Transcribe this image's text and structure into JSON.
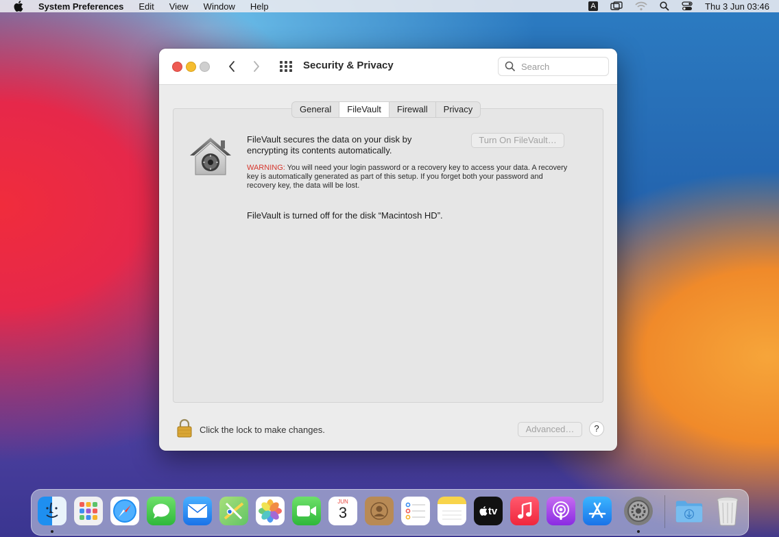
{
  "menubar": {
    "app_name": "System Preferences",
    "menus": [
      "Edit",
      "View",
      "Window",
      "Help"
    ],
    "input_source": "A",
    "clock": "Thu 3 Jun  03:46"
  },
  "window": {
    "title": "Security & Privacy",
    "search_placeholder": "Search",
    "tabs": [
      {
        "label": "General",
        "active": false
      },
      {
        "label": "FileVault",
        "active": true
      },
      {
        "label": "Firewall",
        "active": false
      },
      {
        "label": "Privacy",
        "active": false
      }
    ],
    "filevault": {
      "description": "FileVault secures the data on your disk by encrypting its contents automatically.",
      "turn_on_label": "Turn On FileVault…",
      "warning_label": "WARNING:",
      "warning_text": " You will need your login password or a recovery key to access your data. A recovery key is automatically generated as part of this setup. If you forget both your password and recovery key, the data will be lost.",
      "status": "FileVault is turned off for the disk “Macintosh HD”."
    },
    "footer": {
      "lock_text": "Click the lock to make changes.",
      "advanced_label": "Advanced…",
      "help_label": "?"
    }
  },
  "dock": {
    "apps": [
      {
        "name": "finder-icon",
        "running": true
      },
      {
        "name": "launchpad-icon",
        "running": false
      },
      {
        "name": "safari-icon",
        "running": false
      },
      {
        "name": "messages-icon",
        "running": false
      },
      {
        "name": "mail-icon",
        "running": false
      },
      {
        "name": "maps-icon",
        "running": false
      },
      {
        "name": "photos-icon",
        "running": false
      },
      {
        "name": "facetime-icon",
        "running": false
      },
      {
        "name": "calendar-icon",
        "running": false
      },
      {
        "name": "contacts-icon",
        "running": false
      },
      {
        "name": "reminders-icon",
        "running": false
      },
      {
        "name": "notes-icon",
        "running": false
      },
      {
        "name": "apple-tv-icon",
        "running": false
      },
      {
        "name": "music-icon",
        "running": false
      },
      {
        "name": "podcasts-icon",
        "running": false
      },
      {
        "name": "app-store-icon",
        "running": false
      },
      {
        "name": "system-preferences-icon",
        "running": true
      }
    ],
    "calendar": {
      "month": "JUN",
      "day": "3"
    },
    "tv_label": "tv",
    "downloads": "downloads-folder-icon",
    "trash": "trash-icon"
  }
}
